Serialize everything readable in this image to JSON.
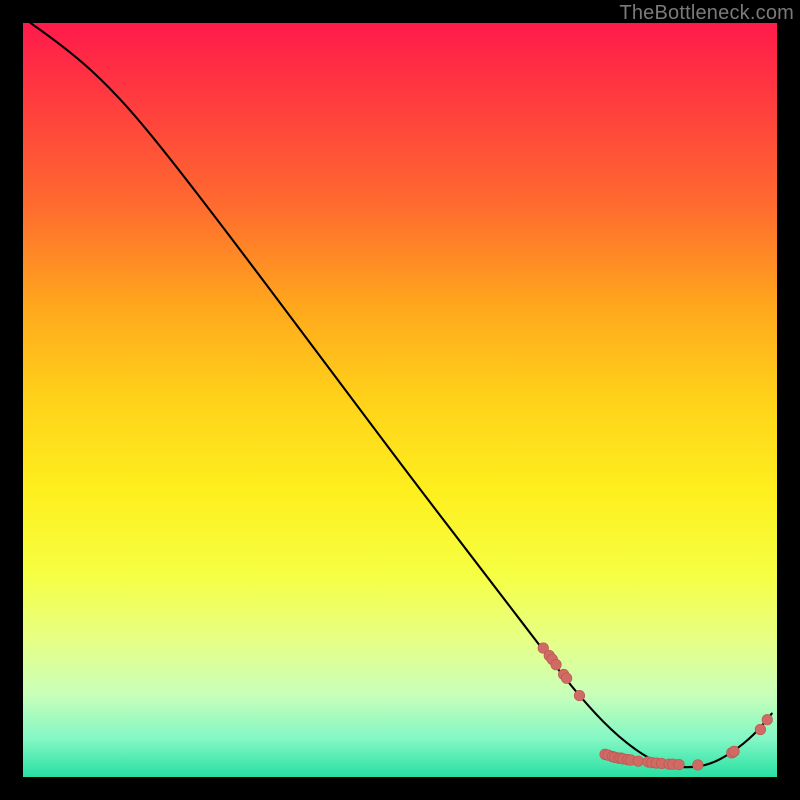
{
  "watermark": "TheBottleneck.com",
  "colors": {
    "curve": "#000000",
    "marker": "#cf6a65",
    "marker_stroke": "#b95650"
  },
  "chart_data": {
    "type": "line",
    "title": "",
    "xlabel": "",
    "ylabel": "",
    "xlim": [
      0,
      100
    ],
    "ylim": [
      0,
      100
    ],
    "grid": false,
    "legend": false,
    "curve_xy": [
      [
        1,
        100
      ],
      [
        6,
        96.5
      ],
      [
        12,
        91
      ],
      [
        18,
        84
      ],
      [
        28,
        71
      ],
      [
        40,
        55
      ],
      [
        52,
        39
      ],
      [
        62,
        26
      ],
      [
        70,
        15.5
      ],
      [
        74,
        10.5
      ],
      [
        78,
        6.2
      ],
      [
        82,
        3.0
      ],
      [
        85,
        1.6
      ],
      [
        88,
        1.2
      ],
      [
        91,
        1.6
      ],
      [
        94,
        3.2
      ],
      [
        97,
        5.6
      ],
      [
        99.3,
        8.4
      ]
    ],
    "markers_xy": [
      [
        69.0,
        17.1
      ],
      [
        69.8,
        16.1
      ],
      [
        70.2,
        15.6
      ],
      [
        70.7,
        14.9
      ],
      [
        71.7,
        13.6
      ],
      [
        72.1,
        13.1
      ],
      [
        73.8,
        10.8
      ],
      [
        77.2,
        3.0
      ],
      [
        77.6,
        2.9
      ],
      [
        78.2,
        2.7
      ],
      [
        78.5,
        2.6
      ],
      [
        79.0,
        2.5
      ],
      [
        79.3,
        2.5
      ],
      [
        79.6,
        2.4
      ],
      [
        80.2,
        2.3
      ],
      [
        80.6,
        2.25
      ],
      [
        81.6,
        2.1
      ],
      [
        82.9,
        2.0
      ],
      [
        83.4,
        1.9
      ],
      [
        84.0,
        1.85
      ],
      [
        84.7,
        1.8
      ],
      [
        85.7,
        1.7
      ],
      [
        86.2,
        1.7
      ],
      [
        87.0,
        1.65
      ],
      [
        89.5,
        1.6
      ],
      [
        94.0,
        3.2
      ],
      [
        94.3,
        3.4
      ],
      [
        97.8,
        6.3
      ],
      [
        98.7,
        7.6
      ]
    ]
  }
}
